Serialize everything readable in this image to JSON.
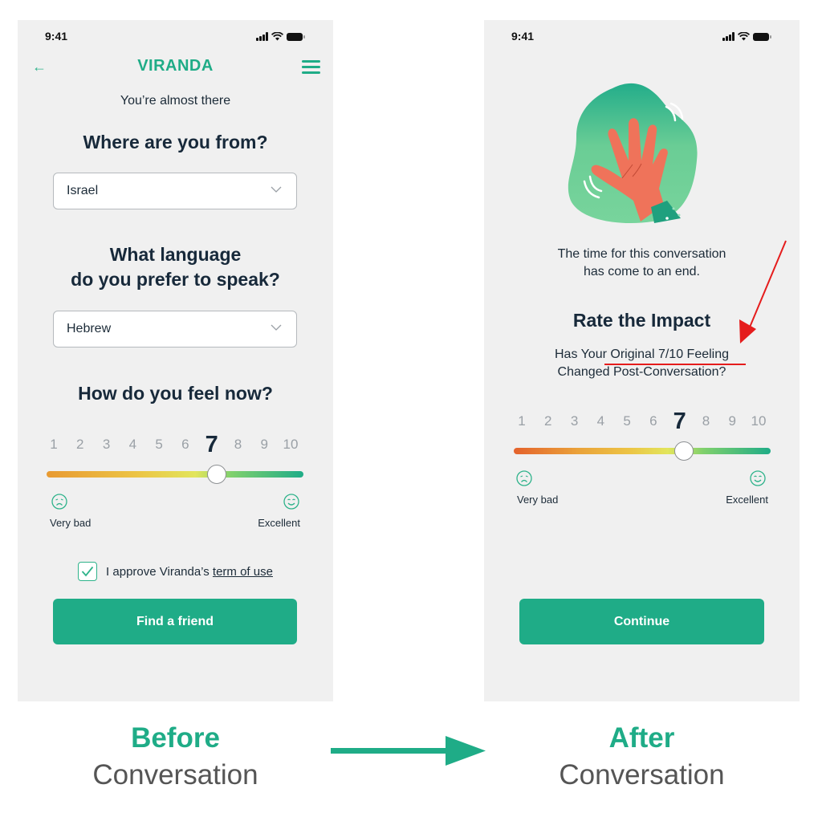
{
  "colors": {
    "brand": "#1fac87",
    "annotation": "#e51c1c"
  },
  "before": {
    "status_time": "9:41",
    "logo": "VIRANDA",
    "subtitle": "You’re almost there",
    "q_country": "Where are you from?",
    "country_value": "Israel",
    "q_language_line1": "What language",
    "q_language_line2": "do you prefer to speak?",
    "language_value": "Hebrew",
    "q_feel": "How do you feel now?",
    "scale": [
      "1",
      "2",
      "3",
      "4",
      "5",
      "6",
      "7",
      "8",
      "9",
      "10"
    ],
    "selected": 7,
    "low_label": "Very bad",
    "high_label": "Excellent",
    "terms_text": "I approve Viranda’s ",
    "terms_link": "term of use",
    "terms_checked": true,
    "cta": "Find a friend"
  },
  "after": {
    "status_time": "9:41",
    "end_line1": "The time for this conversation",
    "end_line2": "has come to an end.",
    "heading": "Rate the Impact",
    "q_line1_prefix": "Has Your ",
    "q_line1_highlight": "Original 7/10 Feeling",
    "q_line2": "Changed Post-Conversation?",
    "scale": [
      "1",
      "2",
      "3",
      "4",
      "5",
      "6",
      "7",
      "8",
      "9",
      "10"
    ],
    "selected": 7,
    "low_label": "Very bad",
    "high_label": "Excellent",
    "cta": "Continue"
  },
  "captions": {
    "before_strong": "Before",
    "before_sub": "Conversation",
    "after_strong": "After",
    "after_sub": "Conversation"
  }
}
